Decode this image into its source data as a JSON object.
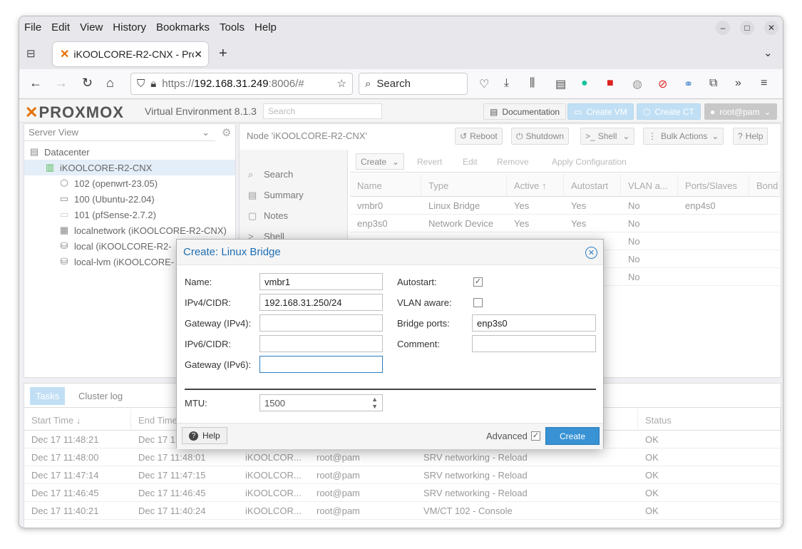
{
  "browser": {
    "menu": [
      "File",
      "Edit",
      "View",
      "History",
      "Bookmarks",
      "Tools",
      "Help"
    ],
    "tab_title": "iKOOLCORE-R2-CNX - Pro",
    "url_prefix": "https://",
    "url_host": "192.168.31.249",
    "url_rest": ":8006/#",
    "search_placeholder": "Search"
  },
  "pve": {
    "logo": "PROXMOX",
    "version": "Virtual Environment 8.1.3",
    "search_placeholder": "Search",
    "documentation": "Documentation",
    "create_vm": "Create VM",
    "create_ct": "Create CT",
    "user": "root@pam"
  },
  "tree": {
    "view_label": "Server View",
    "items": [
      {
        "label": "Datacenter",
        "icon": "datacenter-icon"
      },
      {
        "label": "iKOOLCORE-R2-CNX",
        "icon": "node-icon"
      },
      {
        "label": "102 (openwrt-23.05)",
        "icon": "container-icon"
      },
      {
        "label": "100 (Ubuntu-22.04)",
        "icon": "vm-icon"
      },
      {
        "label": "101 (pfSense-2.7.2)",
        "icon": "vm-icon"
      },
      {
        "label": "localnetwork (iKOOLCORE-R2-CNX)",
        "icon": "network-icon"
      },
      {
        "label": "local (iKOOLCORE-R2-",
        "icon": "storage-icon"
      },
      {
        "label": "local-lvm (iKOOLCORE-",
        "icon": "storage-icon"
      }
    ]
  },
  "node": {
    "title": "Node 'iKOOLCORE-R2-CNX'",
    "reboot": "Reboot",
    "shutdown": "Shutdown",
    "shell": "Shell",
    "bulk": "Bulk Actions",
    "help": "Help",
    "menu": [
      "Search",
      "Summary",
      "Notes",
      "Shell"
    ],
    "toolbar": {
      "create": "Create",
      "revert": "Revert",
      "edit": "Edit",
      "remove": "Remove",
      "apply": "Apply Configuration"
    },
    "columns": [
      "Name",
      "Type",
      "Active ↑",
      "Autostart",
      "VLAN a...",
      "Ports/Slaves",
      "Bond"
    ],
    "rows": [
      [
        "vmbr0",
        "Linux Bridge",
        "Yes",
        "Yes",
        "No",
        "enp4s0",
        ""
      ],
      [
        "enp3s0",
        "Network Device",
        "Yes",
        "Yes",
        "No",
        "",
        ""
      ],
      [
        "",
        "",
        "",
        "",
        "No",
        "",
        ""
      ],
      [
        "",
        "",
        "",
        "",
        "No",
        "",
        ""
      ],
      [
        "",
        "",
        "",
        "",
        "No",
        "",
        ""
      ]
    ]
  },
  "tasks": {
    "tab_tasks": "Tasks",
    "tab_log": "Cluster log",
    "columns": [
      "Start Time ↓",
      "End Time",
      "",
      "",
      "",
      "Status"
    ],
    "rows": [
      [
        "Dec 17 11:48:21",
        "Dec 17 1",
        "",
        "",
        "",
        "OK"
      ],
      [
        "Dec 17 11:48:00",
        "Dec 17 11:48:01",
        "iKOOLCOR...",
        "root@pam",
        "SRV networking - Reload",
        "OK"
      ],
      [
        "Dec 17 11:47:14",
        "Dec 17 11:47:15",
        "iKOOLCOR...",
        "root@pam",
        "SRV networking - Reload",
        "OK"
      ],
      [
        "Dec 17 11:46:45",
        "Dec 17 11:46:45",
        "iKOOLCOR...",
        "root@pam",
        "SRV networking - Reload",
        "OK"
      ],
      [
        "Dec 17 11:40:21",
        "Dec 17 11:40:24",
        "iKOOLCOR...",
        "root@pam",
        "VM/CT 102 - Console",
        "OK"
      ]
    ]
  },
  "dialog": {
    "title": "Create: Linux Bridge",
    "name_label": "Name:",
    "name_value": "vmbr1",
    "ipv4_label": "IPv4/CIDR:",
    "ipv4_value": "192.168.31.250/24",
    "gw4_label": "Gateway (IPv4):",
    "gw4_value": "",
    "ipv6_label": "IPv6/CIDR:",
    "ipv6_value": "",
    "gw6_label": "Gateway (IPv6):",
    "gw6_value": "",
    "autostart_label": "Autostart:",
    "autostart_checked": true,
    "vlan_label": "VLAN aware:",
    "vlan_checked": false,
    "ports_label": "Bridge ports:",
    "ports_value": "enp3s0",
    "comment_label": "Comment:",
    "comment_value": "",
    "mtu_label": "MTU:",
    "mtu_value": "1500",
    "help": "Help",
    "advanced": "Advanced",
    "advanced_checked": true,
    "create": "Create"
  },
  "colors": {
    "accent": "#3892d4",
    "title_blue": "#1f6eb4",
    "brand_orange": "#e57000"
  }
}
